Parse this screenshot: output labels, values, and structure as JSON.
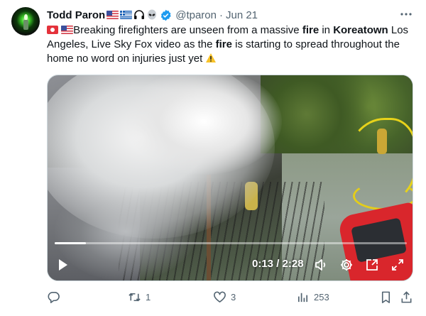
{
  "author": {
    "name": "Todd Paron",
    "handle": "@tparon",
    "separator": "·",
    "time": "Jun 21",
    "badge_icons": [
      "us-flag-icon",
      "greece-flag-icon",
      "headphones-icon",
      "alien-icon"
    ],
    "verified": true
  },
  "tweet": {
    "leading_icons": [
      "japanese-red-button-icon",
      "us-flag-icon"
    ],
    "text_1": "Breaking firefighters are unseen from a massive ",
    "bold_1": "fire",
    "text_2": " in ",
    "bold_2": "Koreatown",
    "text_3": " Los Angeles, Live Sky Fox video as the ",
    "bold_3": "fire",
    "text_4": " is starting to spread throughout the home no word on injuries just yet",
    "trailing_icon": "warning-icon"
  },
  "video": {
    "current_time": "0:13",
    "separator": "/",
    "duration": "2:28",
    "progress": 0.088
  },
  "actions": {
    "reply_count": "",
    "retweet_count": "1",
    "like_count": "3",
    "views_count": "253"
  },
  "colors": {
    "text": "#0f1419",
    "muted": "#536471",
    "verified": "#1d9bf0"
  }
}
